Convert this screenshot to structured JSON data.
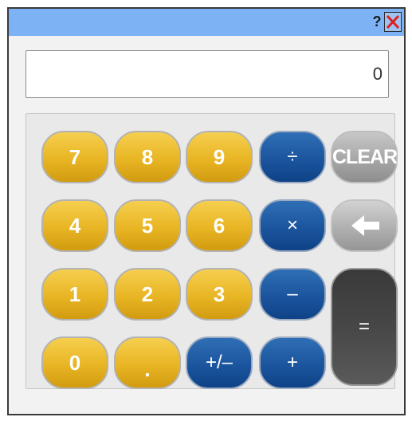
{
  "titlebar": {
    "help_label": "?",
    "close_icon": "close-x-icon",
    "close_color": "#e02020"
  },
  "display": {
    "value": "0"
  },
  "keys": {
    "seven": "7",
    "eight": "8",
    "nine": "9",
    "divide": "÷",
    "clear": "CLEAR",
    "four": "4",
    "five": "5",
    "six": "6",
    "multiply": "×",
    "backspace_icon": "arrow-left-icon",
    "one": "1",
    "two": "2",
    "three": "3",
    "subtract": "–",
    "equals": "=",
    "zero": "0",
    "decimal": ".",
    "negate": "+/–",
    "add": "+"
  },
  "colors": {
    "titlebar": "#7db3f5",
    "number_key": "#e8b524",
    "operator_key": "#1b559e",
    "clear_key": "#a7a7a7",
    "equals_key": "#474747"
  }
}
